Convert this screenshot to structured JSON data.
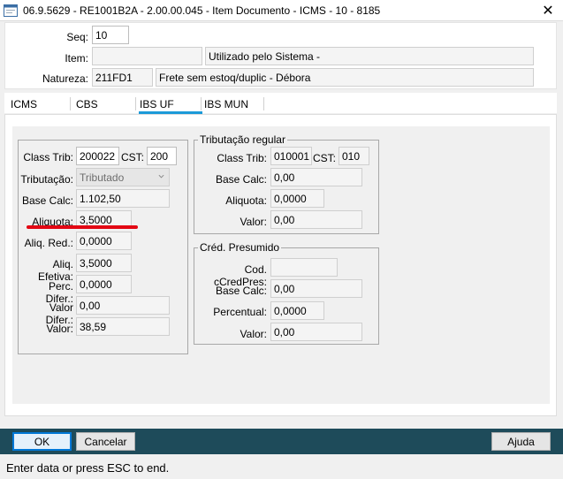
{
  "window": {
    "title": "06.9.5629 - RE1001B2A - 2.00.00.045 - Item Documento - ICMS - 10 - 8185"
  },
  "header": {
    "seq_label": "Seq:",
    "seq_value": "10",
    "item_label": "Item:",
    "item_value": "",
    "item_desc": "Utilizado pelo Sistema -",
    "natureza_label": "Natureza:",
    "natureza_value": "211FD1",
    "natureza_desc": "Frete sem estoq/duplic - Débora"
  },
  "tabs": [
    {
      "label": "ICMS",
      "active": false
    },
    {
      "label": "CBS",
      "active": false
    },
    {
      "label": "IBS UF",
      "active": true
    },
    {
      "label": "IBS MUN",
      "active": false
    }
  ],
  "left": {
    "class_trib_label": "Class Trib:",
    "class_trib_value": "200022",
    "cst_label": "CST:",
    "cst_value": "200",
    "tributacao_label": "Tributação:",
    "tributacao_value": "Tributado",
    "base_calc_label": "Base Calc:",
    "base_calc_value": "1.102,50",
    "aliquota_label": "Aliquota:",
    "aliquota_value": "3,5000",
    "aliq_red_label": "Aliq. Red.:",
    "aliq_red_value": "0,0000",
    "aliq_efetiva_label": "Aliq. Efetiva:",
    "aliq_efetiva_value": "3,5000",
    "perc_difer_label": "Perc. Difer.:",
    "perc_difer_value": "0,0000",
    "valor_difer_label": "Valor Difer.:",
    "valor_difer_value": "0,00",
    "valor_label": "Valor:",
    "valor_value": "38,59"
  },
  "regular": {
    "title": "Tributação regular",
    "class_trib_label": "Class Trib:",
    "class_trib_value": "010001",
    "cst_label": "CST:",
    "cst_value": "010",
    "base_calc_label": "Base Calc:",
    "base_calc_value": "0,00",
    "aliquota_label": "Aliquota:",
    "aliquota_value": "0,0000",
    "valor_label": "Valor:",
    "valor_value": "0,00"
  },
  "presumido": {
    "title": "Créd. Presumido",
    "cod_label": "Cod. cCredPres:",
    "cod_value": "",
    "base_calc_label": "Base Calc:",
    "base_calc_value": "0,00",
    "percentual_label": "Percentual:",
    "percentual_value": "0,0000",
    "valor_label": "Valor:",
    "valor_value": "0,00"
  },
  "buttons": {
    "ok": "OK",
    "cancel": "Cancelar",
    "help": "Ajuda"
  },
  "status": {
    "text": "Enter data or press ESC to end."
  },
  "colors": {
    "tab_active": "#1b9ad8",
    "bottom_bar": "#1e4b5a",
    "highlight_mark": "#e30613"
  }
}
